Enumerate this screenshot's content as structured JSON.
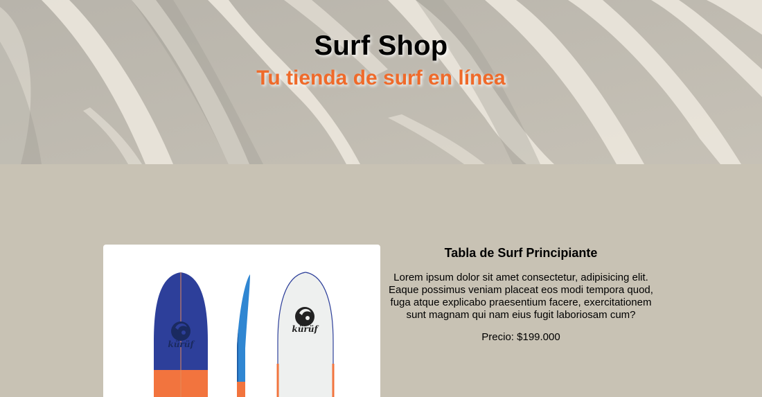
{
  "hero": {
    "title": "Surf Shop",
    "subtitle": "Tu tienda de surf en línea"
  },
  "product": {
    "title": "Tabla de Surf Principiante",
    "description": "Lorem ipsum dolor sit amet consectetur, adipisicing elit. Eaque possimus veniam placeat eos modi tempora quod, fuga atque explicabo praesentium facere, exercitationem sunt magnam qui nam eius fugit laboriosam cum?",
    "price": "Precio: $199.000",
    "brand_logo_text": "kürüf"
  },
  "colors": {
    "background": "#c8c2b4",
    "accent": "#ef6a2a",
    "board_blue": "#2d3f9a",
    "board_orange": "#f2743e"
  }
}
